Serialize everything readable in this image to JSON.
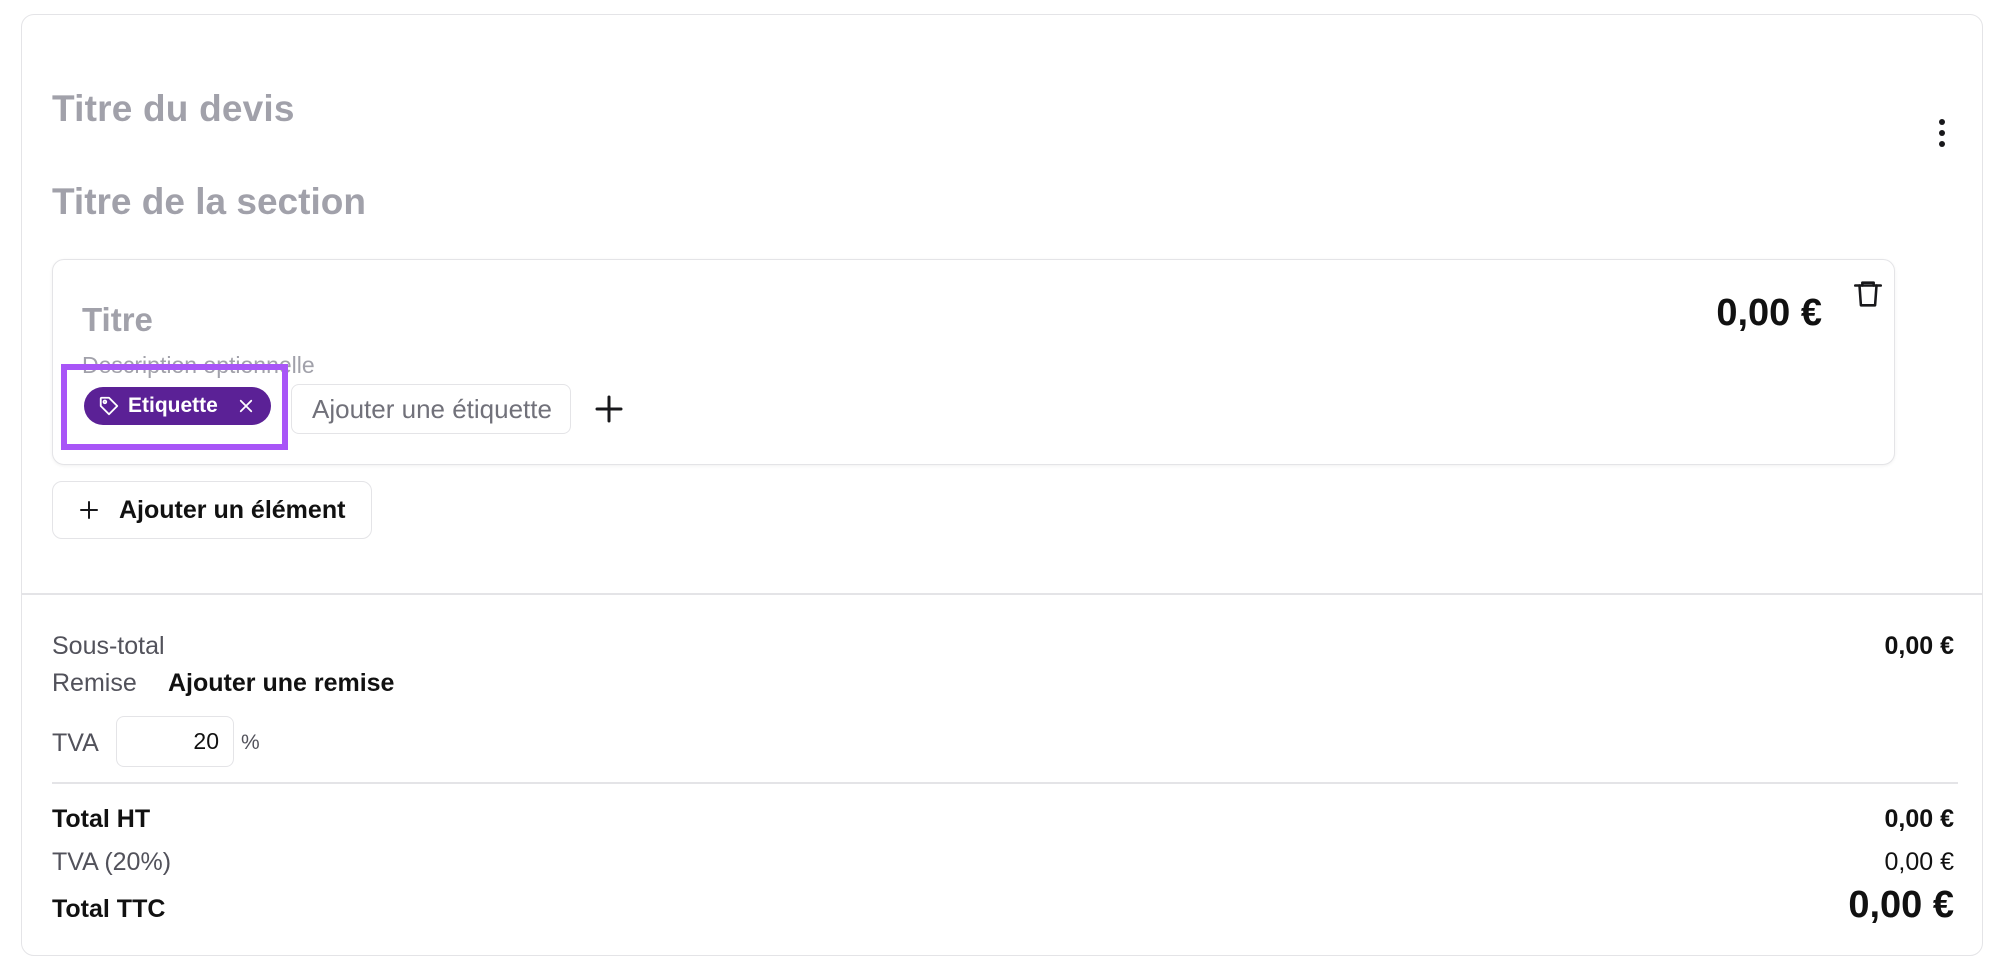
{
  "quote": {
    "title_placeholder": "Titre du devis",
    "section_title_placeholder": "Titre de la section"
  },
  "item": {
    "title_placeholder": "Titre",
    "description_placeholder": "Description optionnelle",
    "price": "0,00 €",
    "tag_label": "Etiquette",
    "tag_input_placeholder": "Ajouter une étiquette"
  },
  "actions": {
    "add_element_label": "Ajouter un élément"
  },
  "summary": {
    "subtotal_label": "Sous-total",
    "subtotal_value": "0,00 €",
    "discount_label": "Remise",
    "discount_link": "Ajouter une remise",
    "vat_label": "TVA",
    "vat_rate_value": "20",
    "vat_unit": "%",
    "total_ht_label": "Total HT",
    "total_ht_value": "0,00 €",
    "vat_amount_label": "TVA (20%)",
    "vat_amount_value": "0,00 €",
    "total_ttc_label": "Total TTC",
    "total_ttc_value": "0,00 €"
  },
  "colors": {
    "tag_background": "#5b2196",
    "highlight": "#a855f7",
    "placeholder_text": "#a1a1aa",
    "border": "#e4e4e7"
  },
  "icons": [
    "more-vertical-icon",
    "trash-icon",
    "tag-icon",
    "close-icon",
    "plus-icon"
  ]
}
